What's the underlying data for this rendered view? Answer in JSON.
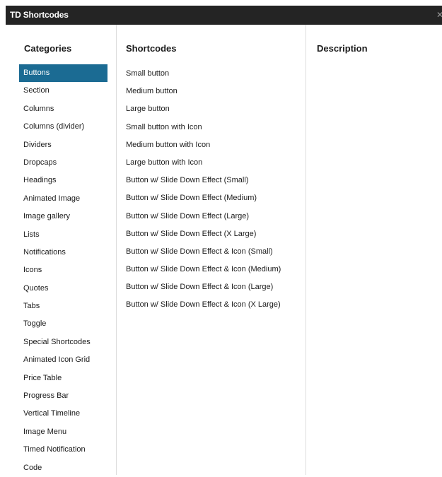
{
  "window": {
    "title": "TD Shortcodes",
    "close_glyph": "✕"
  },
  "headers": {
    "categories": "Categories",
    "shortcodes": "Shortcodes",
    "description": "Description"
  },
  "categories": [
    {
      "label": "Buttons",
      "selected": true
    },
    {
      "label": "Section"
    },
    {
      "label": "Columns"
    },
    {
      "label": "Columns (divider)"
    },
    {
      "label": "Dividers"
    },
    {
      "label": "Dropcaps"
    },
    {
      "label": "Headings"
    },
    {
      "label": "Animated Image"
    },
    {
      "label": "Image gallery"
    },
    {
      "label": "Lists"
    },
    {
      "label": "Notifications"
    },
    {
      "label": "Icons"
    },
    {
      "label": "Quotes"
    },
    {
      "label": "Tabs"
    },
    {
      "label": "Toggle"
    },
    {
      "label": "Special Shortcodes"
    },
    {
      "label": "Animated Icon Grid"
    },
    {
      "label": "Price Table"
    },
    {
      "label": "Progress Bar"
    },
    {
      "label": "Vertical Timeline"
    },
    {
      "label": "Image Menu"
    },
    {
      "label": "Timed Notification"
    },
    {
      "label": "Code"
    }
  ],
  "shortcodes": [
    "Small button",
    "Medium button",
    "Large button",
    "Small button with Icon",
    "Medium button with Icon",
    "Large button with Icon",
    "Button w/ Slide Down Effect (Small)",
    "Button w/ Slide Down Effect (Medium)",
    "Button w/ Slide Down Effect (Large)",
    "Button w/ Slide Down Effect (X Large)",
    "Button w/ Slide Down Effect & Icon (Small)",
    "Button w/ Slide Down Effect & Icon (Medium)",
    "Button w/ Slide Down Effect & Icon (Large)",
    "Button w/ Slide Down Effect & Icon (X Large)"
  ],
  "colors": {
    "titlebar": "#242424",
    "selected": "#1b6b93",
    "divider": "#dcdcdc"
  }
}
